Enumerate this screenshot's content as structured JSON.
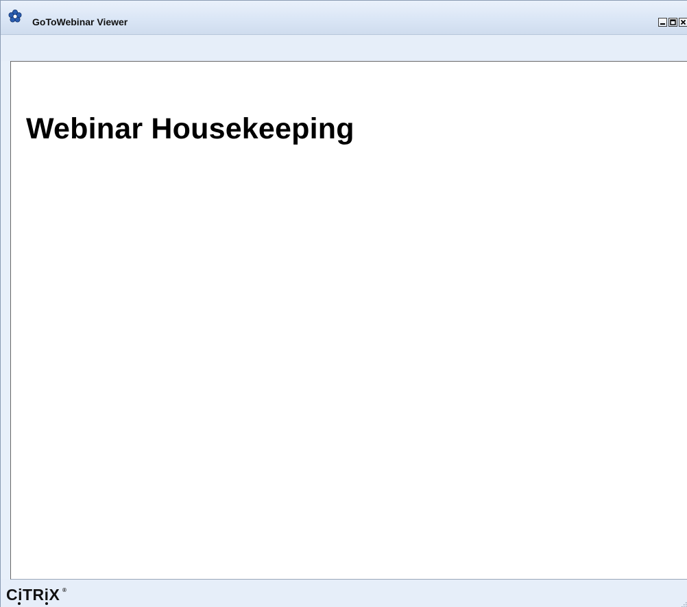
{
  "window": {
    "title": "GoToWebinar Viewer",
    "app_icon": "gotowebinar-flower-icon"
  },
  "controls": {
    "minimize_icon": "minimize-icon",
    "maximize_icon": "maximize-icon",
    "close_icon": "close-icon"
  },
  "slide": {
    "title": "Webinar Housekeeping"
  },
  "footer": {
    "logo_text": "CiTRiX",
    "logo_mark": "®"
  },
  "colors": {
    "titlebar_bg": "#d9e5f5",
    "panel_bg": "#e6eef9",
    "slide_bg": "#ffffff",
    "text": "#000000",
    "icon_blue": "#2a5db0"
  }
}
